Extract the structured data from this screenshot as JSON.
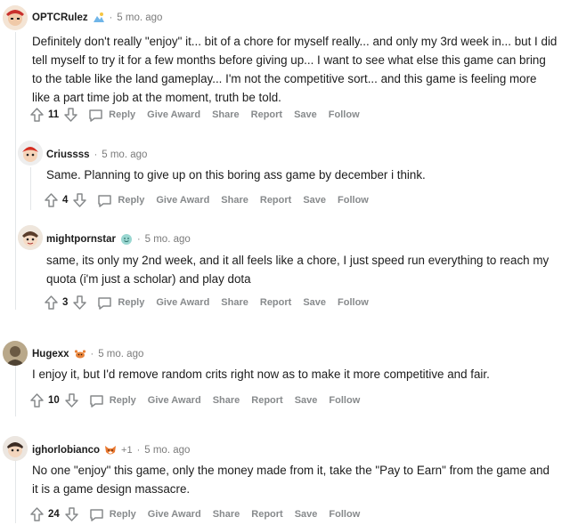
{
  "comments": [
    {
      "user": "OPTCRulez",
      "time": "5 mo. ago",
      "body": "Definitely don't really \"enjoy\" it... bit of a chore for myself really... and only my 3rd week in... but I did tell myself to try it for a few months before giving up... I want to see what else this game can bring to the table like the land gameplay... I'm not the competitive sort... and this game is feeling more like a part time job at the moment, truth be told.",
      "score": "11",
      "flair_icon": "mountain-icon"
    },
    {
      "user": "Criussss",
      "time": "5 mo. ago",
      "body": "Same. Planning to give up on this boring ass game by december i think.",
      "score": "4"
    },
    {
      "user": "mightpornstar",
      "time": "5 mo. ago",
      "body": "same, its only my 2nd week, and it all feels like a chore, I just speed run everything to reach my quota (i'm just a scholar) and play dota",
      "score": "3",
      "flair_icon": "smiley-icon"
    },
    {
      "user": "Hugexx",
      "time": "5 mo. ago",
      "body": "I enjoy it, but I'd remove random crits right now as to make it more competitive and fair.",
      "score": "10",
      "flair_icon": "crab-icon"
    },
    {
      "user": "ighorlobianco",
      "karma": "+1",
      "time": "5 mo. ago",
      "body": "No one \"enjoy\" this game, only the money made from it, take the \"Pay to Earn\" from the game and it is a game design massacre.",
      "score": "24",
      "flair_icon": "fox-icon"
    }
  ],
  "actions": {
    "reply": "Reply",
    "give_award": "Give Award",
    "share": "Share",
    "report": "Report",
    "save": "Save",
    "follow": "Follow"
  },
  "separator": "·",
  "colors": {
    "meta_gray": "#7c7c7c",
    "action_gray": "#878a8c",
    "thread_line": "#e3e6e8",
    "text": "#1c1c1c"
  }
}
